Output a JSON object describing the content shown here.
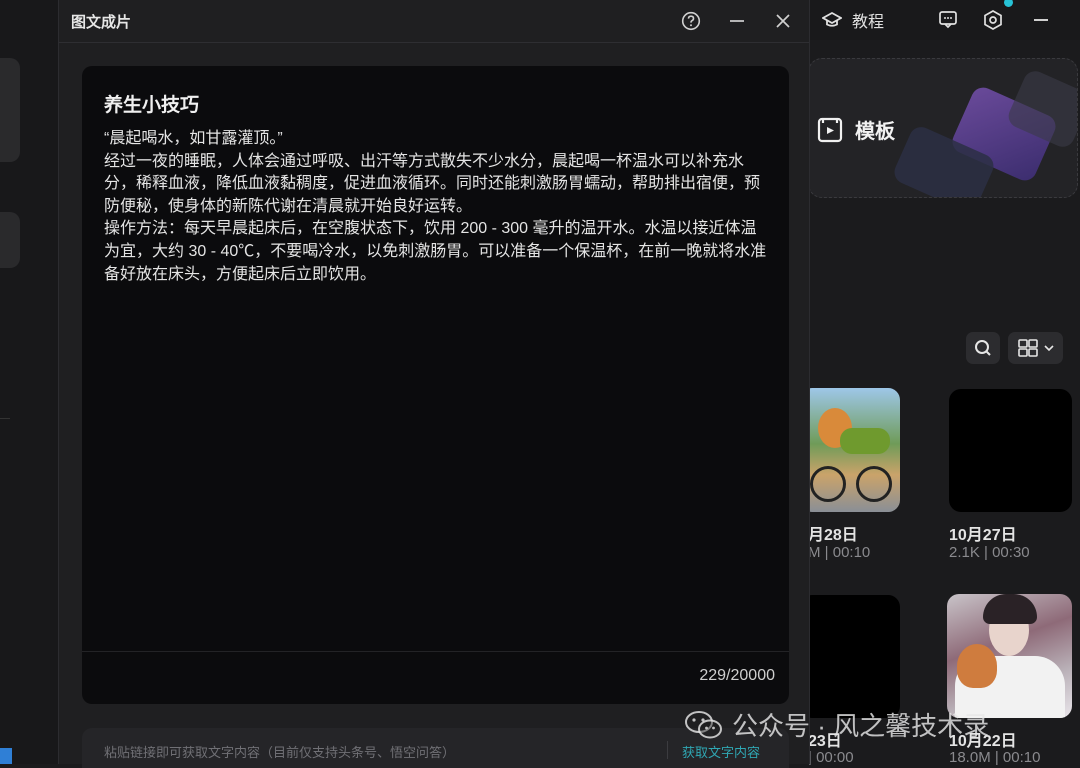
{
  "dialog": {
    "title": "图文成片",
    "editor_title": "养生小技巧",
    "editor_body": "“晨起喝水，如甘露灌顶。”\n经过一夜的睡眠，人体会通过呼吸、出汗等方式散失不少水分，晨起喝一杯温水可以补充水分，稀释血液，降低血液黏稠度，促进血液循环。同时还能刺激肠胃蠕动，帮助排出宿便，预防便秘，使身体的新陈代谢在清晨就开始良好运转。\n操作方法：每天早晨起床后，在空腹状态下，饮用 200 - 300 毫升的温开水。水温以接近体温为宜，大约 30 - 40℃，不要喝冷水，以免刺激肠胃。可以准备一个保温杯，在前一晚就将水准备好放在床头，方便起床后立即饮用。",
    "char_count": "229/20000",
    "link_placeholder": "粘贴链接即可获取文字内容（目前仅支持头条号、悟空问答）",
    "link_button": "获取文字内容"
  },
  "topbar": {
    "tutorial_label": "教程"
  },
  "template_card": {
    "label": "模板"
  },
  "videos": [
    {
      "date": "月28日",
      "meta": "M | 00:10"
    },
    {
      "date": "10月27日",
      "meta": "2.1K | 00:30"
    },
    {
      "date": "23日",
      "meta": "| 00:00"
    },
    {
      "date": "10月22日",
      "meta": "18.0M | 00:10"
    }
  ],
  "watermark": "公众号 · 风之馨技术录",
  "colors": {
    "accent": "#2fa7b3",
    "dialog_bg": "#1f1f21",
    "editor_bg": "#0b0b0d"
  }
}
